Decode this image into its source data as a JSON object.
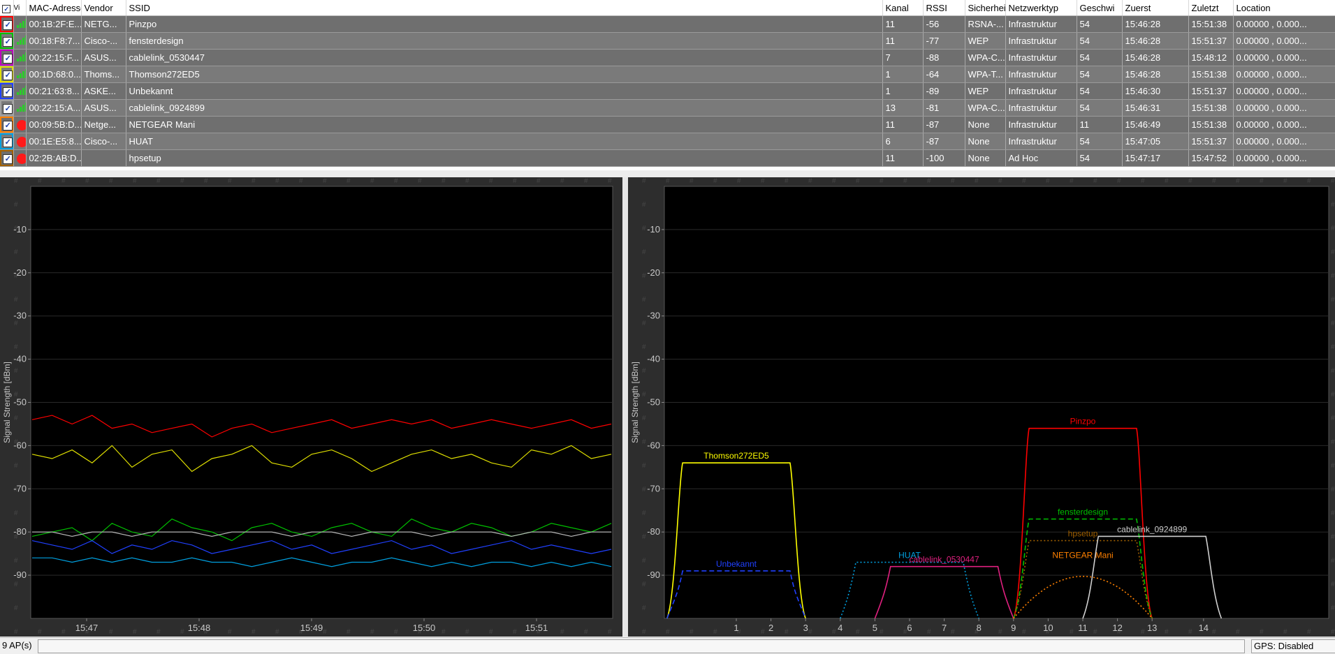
{
  "table": {
    "columns": [
      "Vi",
      "MAC-Adresse",
      "Vendor",
      "SSID",
      "Kanal",
      "RSSI",
      "Sicherheit",
      "Netzwerktyp",
      "Geschwi",
      "Zuerst",
      "Zuletzt",
      "Location"
    ],
    "rows": [
      {
        "color": "#ff0000",
        "status": "signal",
        "mac": "00:1B:2F:E...",
        "vendor": "NETG...",
        "ssid": "Pinzpo",
        "kanal": "11",
        "rssi": "-56",
        "sec": "RSNA-...",
        "type": "Infrastruktur",
        "speed": "54",
        "first": "15:46:28",
        "last": "15:51:38",
        "loc": "0.00000 , 0.000..."
      },
      {
        "color": "#00c000",
        "status": "signal",
        "mac": "00:18:F8:7...",
        "vendor": "Cisco-...",
        "ssid": "fensterdesign",
        "kanal": "11",
        "rssi": "-77",
        "sec": "WEP",
        "type": "Infrastruktur",
        "speed": "54",
        "first": "15:46:28",
        "last": "15:51:37",
        "loc": "0.00000 , 0.000..."
      },
      {
        "color": "#c000c0",
        "status": "signal",
        "mac": "00:22:15:F...",
        "vendor": "ASUS...",
        "ssid": "cablelink_0530447",
        "kanal": "7",
        "rssi": "-88",
        "sec": "WPA-C...",
        "type": "Infrastruktur",
        "speed": "54",
        "first": "15:46:28",
        "last": "15:48:12",
        "loc": "0.00000 , 0.000..."
      },
      {
        "color": "#e0e000",
        "status": "signal",
        "mac": "00:1D:68:0...",
        "vendor": "Thoms...",
        "ssid": "Thomson272ED5",
        "kanal": "1",
        "rssi": "-64",
        "sec": "WPA-T...",
        "type": "Infrastruktur",
        "speed": "54",
        "first": "15:46:28",
        "last": "15:51:38",
        "loc": "0.00000 , 0.000..."
      },
      {
        "color": "#2040ff",
        "status": "signal",
        "mac": "00:21:63:8...",
        "vendor": "ASKE...",
        "ssid": "Unbekannt",
        "kanal": "1",
        "rssi": "-89",
        "sec": "WEP",
        "type": "Infrastruktur",
        "speed": "54",
        "first": "15:46:30",
        "last": "15:51:37",
        "loc": "0.00000 , 0.000..."
      },
      {
        "color": "#a0a0a0",
        "status": "signal",
        "mac": "00:22:15:A...",
        "vendor": "ASUS...",
        "ssid": "cablelink_0924899",
        "kanal": "13",
        "rssi": "-81",
        "sec": "WPA-C...",
        "type": "Infrastruktur",
        "speed": "54",
        "first": "15:46:31",
        "last": "15:51:38",
        "loc": "0.00000 , 0.000..."
      },
      {
        "color": "#ff8000",
        "status": "stop",
        "mac": "00:09:5B:D...",
        "vendor": "Netge...",
        "ssid": "NETGEAR Mani",
        "kanal": "11",
        "rssi": "-87",
        "sec": "None",
        "type": "Infrastruktur",
        "speed": "11",
        "first": "15:46:49",
        "last": "15:51:38",
        "loc": "0.00000 , 0.000..."
      },
      {
        "color": "#00a0e0",
        "status": "stop",
        "mac": "00:1E:E5:8...",
        "vendor": "Cisco-...",
        "ssid": "HUAT",
        "kanal": "6",
        "rssi": "-87",
        "sec": "None",
        "type": "Infrastruktur",
        "speed": "54",
        "first": "15:47:05",
        "last": "15:51:37",
        "loc": "0.00000 , 0.000..."
      },
      {
        "color": "#a06000",
        "status": "stop",
        "mac": "02:2B:AB:D...",
        "vendor": "",
        "ssid": "hpsetup",
        "kanal": "11",
        "rssi": "-100",
        "sec": "None",
        "type": "Ad Hoc",
        "speed": "54",
        "first": "15:47:17",
        "last": "15:47:52",
        "loc": "0.00000 , 0.000..."
      }
    ]
  },
  "time_chart": {
    "ylabel": "Signal Strength [dBm]",
    "yticks": [
      -10,
      -20,
      -30,
      -40,
      -50,
      -60,
      -70,
      -80,
      -90
    ],
    "xticks": [
      "15:47",
      "15:48",
      "15:49",
      "15:50",
      "15:51"
    ]
  },
  "channel_chart": {
    "ylabel": "Signal Strength [dBm]",
    "yticks": [
      -10,
      -20,
      -30,
      -40,
      -50,
      -60,
      -70,
      -80,
      -90
    ],
    "xticks": [
      "1",
      "2",
      "3",
      "4",
      "5",
      "6",
      "7",
      "8",
      "9",
      "10",
      "11",
      "12",
      "13",
      "14"
    ]
  },
  "chart_data": [
    {
      "type": "line",
      "ylabel": "Signal Strength [dBm]",
      "xlabel": "",
      "ylim": [
        -100,
        0
      ],
      "x_ticks": [
        "15:47",
        "15:48",
        "15:49",
        "15:50",
        "15:51"
      ],
      "series": [
        {
          "name": "Pinzpo",
          "color": "#ff0000",
          "values": [
            -54,
            -53,
            -55,
            -53,
            -56,
            -55,
            -57,
            -56,
            -55,
            -58,
            -56,
            -55,
            -57,
            -56,
            -55,
            -54,
            -56,
            -55,
            -54,
            -55,
            -54,
            -56,
            -55,
            -54,
            -55,
            -56,
            -55,
            -54,
            -56,
            -55
          ]
        },
        {
          "name": "Thomson272ED5",
          "color": "#e0e000",
          "values": [
            -62,
            -63,
            -61,
            -64,
            -60,
            -65,
            -62,
            -61,
            -66,
            -63,
            -62,
            -60,
            -64,
            -65,
            -62,
            -61,
            -63,
            -66,
            -64,
            -62,
            -61,
            -63,
            -62,
            -64,
            -65,
            -61,
            -62,
            -60,
            -63,
            -62
          ]
        },
        {
          "name": "fensterdesign",
          "color": "#00c000",
          "values": [
            -81,
            -80,
            -79,
            -82,
            -78,
            -80,
            -81,
            -77,
            -79,
            -80,
            -82,
            -79,
            -78,
            -80,
            -81,
            -79,
            -78,
            -80,
            -81,
            -77,
            -79,
            -80,
            -78,
            -79,
            -81,
            -80,
            -78,
            -79,
            -80,
            -78
          ]
        },
        {
          "name": "Unbekannt",
          "color": "#2040ff",
          "values": [
            -82,
            -83,
            -84,
            -82,
            -85,
            -83,
            -84,
            -82,
            -83,
            -85,
            -84,
            -83,
            -82,
            -84,
            -83,
            -85,
            -84,
            -83,
            -82,
            -84,
            -83,
            -85,
            -84,
            -83,
            -82,
            -84,
            -83,
            -84,
            -85,
            -84
          ]
        },
        {
          "name": "cablelink_0924899",
          "color": "#c0c0c0",
          "values": [
            -80,
            -80,
            -81,
            -80,
            -80,
            -81,
            -80,
            -80,
            -80,
            -81,
            -80,
            -80,
            -80,
            -81,
            -80,
            -80,
            -81,
            -80,
            -80,
            -80,
            -81,
            -80,
            -80,
            -80,
            -81,
            -80,
            -80,
            -81,
            -80,
            -80
          ]
        },
        {
          "name": "HUAT",
          "color": "#00a0e0",
          "values": [
            -86,
            -86,
            -87,
            -86,
            -87,
            -86,
            -87,
            -87,
            -86,
            -87,
            -87,
            -88,
            -87,
            -86,
            -87,
            -88,
            -87,
            -87,
            -86,
            -87,
            -88,
            -87,
            -88,
            -87,
            -87,
            -88,
            -87,
            -88,
            -87,
            -88
          ]
        }
      ]
    },
    {
      "type": "area",
      "ylabel": "Signal Strength [dBm]",
      "xlabel": "",
      "ylim": [
        -100,
        0
      ],
      "x_ticks": [
        "1",
        "2",
        "3",
        "4",
        "5",
        "6",
        "7",
        "8",
        "9",
        "10",
        "11",
        "12",
        "13",
        "14"
      ],
      "series": [
        {
          "name": "Thomson272ED5",
          "channel": 1,
          "rssi": -64,
          "color": "#ffff00",
          "style": "solid"
        },
        {
          "name": "Unbekannt",
          "channel": 1,
          "rssi": -89,
          "color": "#2040ff",
          "style": "dashed"
        },
        {
          "name": "HUAT",
          "channel": 6,
          "rssi": -87,
          "color": "#00a0e0",
          "style": "dotted"
        },
        {
          "name": "cablelink_0530447",
          "channel": 7,
          "rssi": -88,
          "color": "#e0207f",
          "style": "solid"
        },
        {
          "name": "Pinzpo",
          "channel": 11,
          "rssi": -56,
          "color": "#ff0000",
          "style": "solid"
        },
        {
          "name": "fensterdesign",
          "channel": 11,
          "rssi": -77,
          "color": "#00c000",
          "style": "dashed"
        },
        {
          "name": "hpsetup",
          "channel": 11,
          "rssi": -82,
          "color": "#a06000",
          "style": "dotted"
        },
        {
          "name": "NETGEAR Mani",
          "channel": 11,
          "rssi": -87,
          "color": "#ff8000",
          "style": "dotted"
        },
        {
          "name": "cablelink_0924899",
          "channel": 13,
          "rssi": -81,
          "color": "#d0d0d0",
          "style": "solid"
        }
      ]
    }
  ],
  "status": {
    "ap_count": "9 AP(s)",
    "gps": "GPS: Disabled"
  }
}
